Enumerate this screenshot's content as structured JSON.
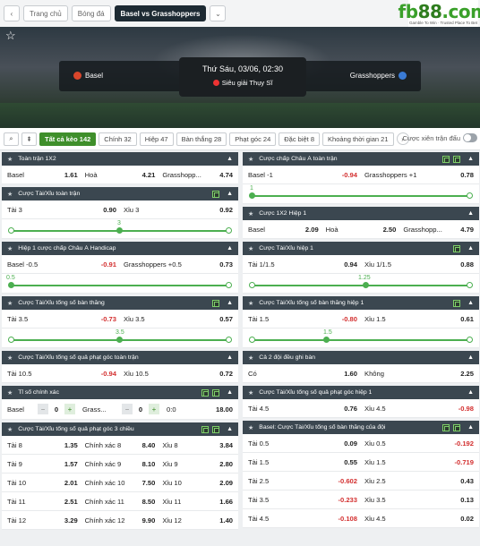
{
  "topbar": {
    "breadcrumb": [
      "Trang chủ",
      "Bóng đá",
      "Basel vs Grasshoppers"
    ],
    "logo_main": "fb88.com",
    "logo_sub": "Gamble To Win · Trusted Place To Bet"
  },
  "match": {
    "home": "Basel",
    "away": "Grasshoppers",
    "datetime": "Thứ Sáu, 03/06, 02:30",
    "league": "Siêu giải Thụy Sĩ"
  },
  "filters": {
    "chips": [
      "Tất cả kèo 142",
      "Chính 32",
      "Hiệp 47",
      "Bàn thắng 28",
      "Phạt góc 24",
      "Đặc biệt 8",
      "Khoảng thời gian 21"
    ],
    "toggle_label": "Cược xiên trận đấu"
  },
  "left": {
    "s1": {
      "title": "Toàn trận 1X2",
      "row": [
        [
          "Basel",
          "1.61"
        ],
        [
          "Hoà",
          "4.21"
        ],
        [
          "Grasshopp...",
          "4.74"
        ]
      ]
    },
    "s2": {
      "title": "Cược Tài/Xỉu toàn trận",
      "row": [
        [
          "Tài 3",
          "0.90"
        ],
        [
          "Xỉu 3",
          "0.92"
        ]
      ],
      "slider": "3"
    },
    "s3": {
      "title": "Hiệp 1 cược chấp Châu Á Handicap",
      "row": [
        [
          "Basel -0.5",
          "-0.91"
        ],
        [
          "Grasshoppers +0.5",
          "0.73"
        ]
      ],
      "slider": "0.5"
    },
    "s4": {
      "title": "Cược Tài/Xỉu tổng số bàn thắng",
      "row": [
        [
          "Tài 3.5",
          "-0.73"
        ],
        [
          "Xỉu 3.5",
          "0.57"
        ]
      ],
      "slider": "3.5"
    },
    "s5": {
      "title": "Cược Tài/Xỉu tổng số quả phạt góc toàn trận",
      "row": [
        [
          "Tài 10.5",
          "-0.94"
        ],
        [
          "Xỉu 10.5",
          "0.72"
        ]
      ]
    },
    "s6": {
      "title": "Tỉ số chính xác",
      "home": "Basel",
      "home_score": "0",
      "away": "Grass...",
      "away_score": "0",
      "result": "0:0",
      "odds": "18.00"
    },
    "s7": {
      "title": "Cược Tài/Xỉu tổng số quả phạt góc 3 chiều",
      "rows": [
        [
          [
            "Tài 8",
            "1.35"
          ],
          [
            "Chính xác 8",
            "8.40"
          ],
          [
            "Xỉu 8",
            "3.84"
          ]
        ],
        [
          [
            "Tài 9",
            "1.57"
          ],
          [
            "Chính xác 9",
            "8.10"
          ],
          [
            "Xỉu 9",
            "2.80"
          ]
        ],
        [
          [
            "Tài 10",
            "2.01"
          ],
          [
            "Chính xác 10",
            "7.50"
          ],
          [
            "Xỉu 10",
            "2.09"
          ]
        ],
        [
          [
            "Tài 11",
            "2.51"
          ],
          [
            "Chính xác 11",
            "8.50"
          ],
          [
            "Xỉu 11",
            "1.66"
          ]
        ],
        [
          [
            "Tài 12",
            "3.29"
          ],
          [
            "Chính xác 12",
            "9.90"
          ],
          [
            "Xỉu 12",
            "1.40"
          ]
        ]
      ]
    }
  },
  "right": {
    "s1": {
      "title": "Cược chấp Châu Á toàn trận",
      "row": [
        [
          "Basel -1",
          "-0.94"
        ],
        [
          "Grasshoppers +1",
          "0.78"
        ]
      ],
      "slider": "1"
    },
    "s2": {
      "title": "Cược 1X2 Hiệp 1",
      "row": [
        [
          "Basel",
          "2.09"
        ],
        [
          "Hoà",
          "2.50"
        ],
        [
          "Grasshopp...",
          "4.79"
        ]
      ]
    },
    "s3": {
      "title": "Cược Tài/Xỉu hiệp 1",
      "row": [
        [
          "Tài 1/1.5",
          "0.94"
        ],
        [
          "Xỉu 1/1.5",
          "0.88"
        ]
      ],
      "slider": "1.25"
    },
    "s4": {
      "title": "Cược Tài/Xỉu tổng số bàn thắng hiệp 1",
      "row": [
        [
          "Tài 1.5",
          "-0.80"
        ],
        [
          "Xỉu 1.5",
          "0.61"
        ]
      ],
      "slider": "1.5"
    },
    "s5": {
      "title": "Cả 2 đội đều ghi bàn",
      "row": [
        [
          "Có",
          "1.60"
        ],
        [
          "Không",
          "2.25"
        ]
      ]
    },
    "s6": {
      "title": "Cược Tài/Xỉu tổng số quả phạt góc hiệp 1",
      "row": [
        [
          "Tài 4.5",
          "0.76"
        ],
        [
          "Xỉu 4.5",
          "-0.98"
        ]
      ]
    },
    "s7": {
      "title": "Basel: Cược Tài/Xỉu tổng số bàn thắng của đội",
      "rows": [
        [
          [
            "Tài 0.5",
            "0.09"
          ],
          [
            "Xỉu 0.5",
            "-0.192"
          ]
        ],
        [
          [
            "Tài 1.5",
            "0.55"
          ],
          [
            "Xỉu 1.5",
            "-0.719"
          ]
        ],
        [
          [
            "Tài 2.5",
            "-0.602"
          ],
          [
            "Xỉu 2.5",
            "0.43"
          ]
        ],
        [
          [
            "Tài 3.5",
            "-0.233"
          ],
          [
            "Xỉu 3.5",
            "0.13"
          ]
        ],
        [
          [
            "Tài 4.5",
            "-0.108"
          ],
          [
            "Xỉu 4.5",
            "0.02"
          ]
        ]
      ]
    }
  }
}
